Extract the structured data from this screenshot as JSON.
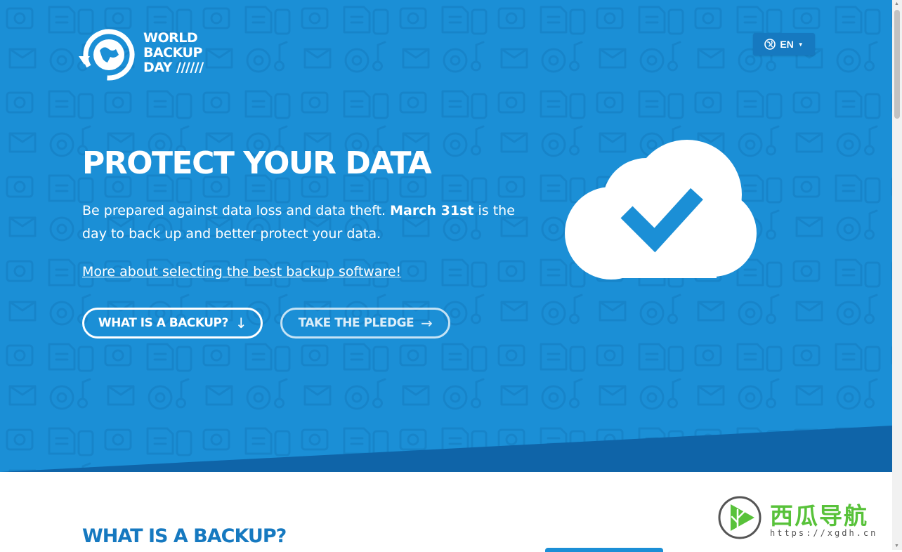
{
  "header": {
    "logo_lines": [
      "WORLD",
      "BACKUP",
      "DAY //////"
    ],
    "language_label": "EN"
  },
  "hero": {
    "title": "PROTECT YOUR DATA",
    "lead_text": "Be prepared against data loss and data theft. ",
    "lead_bold": "March 31st",
    "lead_text_2": " is the day to back up and better protect your data.",
    "link_text": "More about selecting the best backup software!",
    "btn_backup": "WHAT IS A BACKUP?",
    "btn_backup_arrow": "↓",
    "btn_pledge": "TAKE THE PLEDGE",
    "btn_pledge_arrow": "→"
  },
  "section": {
    "title": "WHAT IS A BACKUP?"
  },
  "watermark": {
    "text": "西瓜导航",
    "url": "https://xgdh.cn"
  },
  "colors": {
    "hero_blue": "#1b8fd6",
    "dark_blue": "#1679c0",
    "band_blue": "#0f64a8",
    "watermark_green": "#58c23a"
  },
  "icons": [
    "globe-icon",
    "backup-logo-icon",
    "cloud-check-icon",
    "caret-down-icon",
    "arrow-down-icon",
    "arrow-right-icon",
    "watermark-logo-icon"
  ]
}
